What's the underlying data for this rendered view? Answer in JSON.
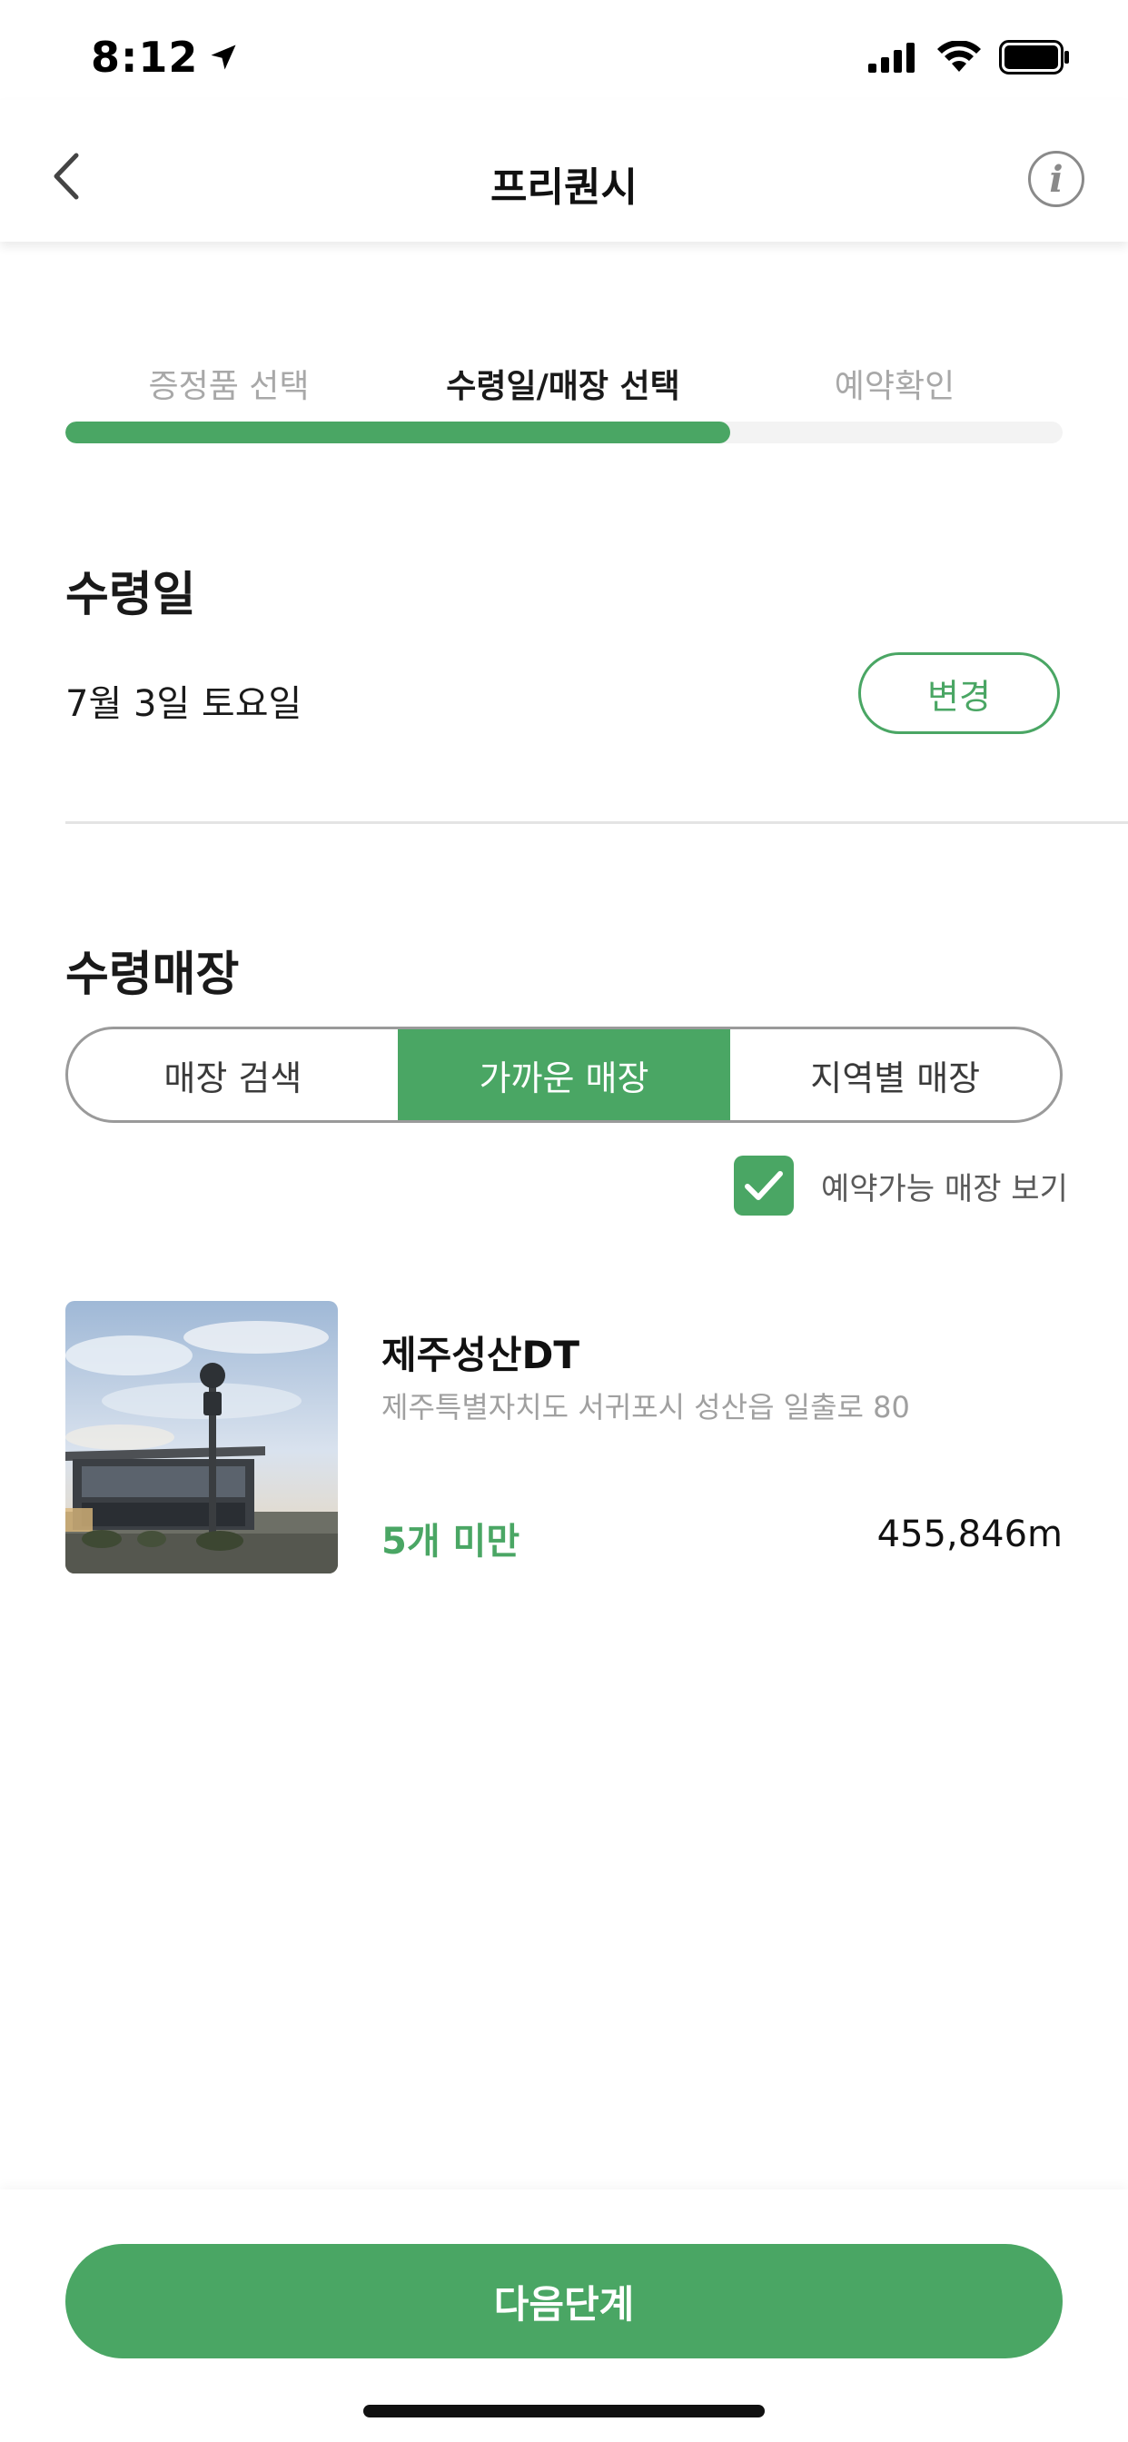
{
  "status_bar": {
    "time": "8:12"
  },
  "nav": {
    "title": "프리퀀시",
    "back_icon": "chevron-left-icon",
    "info_label": "i"
  },
  "steps": {
    "items": [
      {
        "label": "증정품 선택",
        "active": false
      },
      {
        "label": "수령일/매장 선택",
        "active": true
      },
      {
        "label": "예약확인",
        "active": false
      }
    ],
    "progress": 0.667
  },
  "pickup_date": {
    "title": "수령일",
    "value": "7월 3일 토요일",
    "change_label": "변경"
  },
  "pickup_store": {
    "title": "수령매장",
    "segments": [
      {
        "label": "매장 검색",
        "active": false
      },
      {
        "label": "가까운 매장",
        "active": true
      },
      {
        "label": "지역별 매장",
        "active": false
      }
    ],
    "available_only": {
      "label": "예약가능 매장 보기",
      "checked": true
    }
  },
  "stores": [
    {
      "name": "제주성산DT",
      "address": "제주특별자치도 서귀포시 성산읍 일출로 80",
      "stock": "5개 미만",
      "distance": "455,846m"
    }
  ],
  "footer": {
    "next_label": "다음단계"
  },
  "colors": {
    "accent": "#4aa664",
    "text": "#1a1a1a",
    "muted": "#a8a8a8"
  }
}
